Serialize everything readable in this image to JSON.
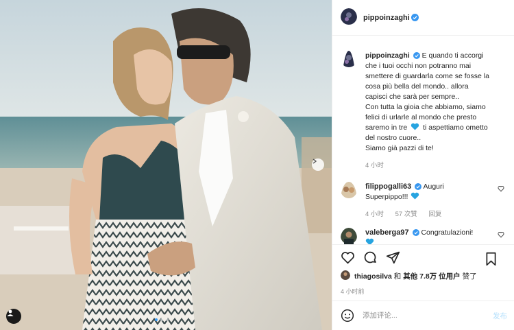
{
  "post": {
    "author": "pippoinzaghi",
    "caption_lines": [
      "E quando ti accorgi",
      "che i tuoi occhi non potranno mai",
      "smettere di guardarla come se fosse la",
      "cosa più bella del mondo.. allora",
      "capisci che sarà per sempre..",
      "Con tutta la gioia che abbiamo, siamo",
      "felici di urlarle al mondo che presto",
      "ti aspettiamo ometto",
      "del nostro cuore..",
      "Siamo già pazzi di te!"
    ],
    "caption_line7_start": "saremo in tre",
    "caption_time": "4 小时",
    "carousel": {
      "total": 3,
      "active_index": 0
    }
  },
  "comments": [
    {
      "user": "filippogalli63",
      "text_line1": "Auguri",
      "text_line2": "Superpippo!!!",
      "time": "4 小时",
      "likes": "57 次赞",
      "reply": "回复"
    },
    {
      "user": "valeberga97",
      "text_line1": "Congratulazioni!"
    }
  ],
  "likes": {
    "user": "thiagosilva",
    "and": "和",
    "others_label": "其他",
    "others_count": "7.8万",
    "others_suffix": "位用户",
    "liked": "赞了"
  },
  "post_time": "4 小时前",
  "add_comment": {
    "placeholder": "添加评论...",
    "post_label": "发布"
  },
  "icons": {
    "verified": "verified-badge-icon",
    "heart": "heart-icon",
    "comment": "comment-icon",
    "share": "paper-plane-icon",
    "save": "bookmark-icon",
    "emoji": "emoji-icon",
    "next": "chevron-right-icon",
    "user_tags": "user-tags-icon"
  },
  "colors": {
    "verified_blue": "#3897f0",
    "heart_emoji_blue": "#27a4e0",
    "post_button_disabled": "#b2dffc",
    "muted_text": "#8e8e8e"
  }
}
